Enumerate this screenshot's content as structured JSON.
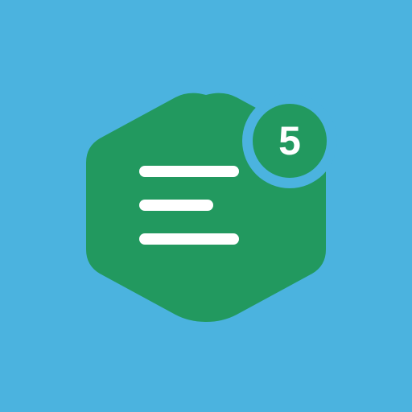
{
  "notification_badge": {
    "count": "5"
  },
  "icons": {
    "main": "document-list-icon",
    "lines": "text-lines-icon"
  },
  "colors": {
    "background": "#4BB3DF",
    "hexagon": "#22995F",
    "badge": "#22995F",
    "badge_ring": "#4BB3DF",
    "lines": "#FFFFFF",
    "badge_text": "#FFFFFF"
  }
}
